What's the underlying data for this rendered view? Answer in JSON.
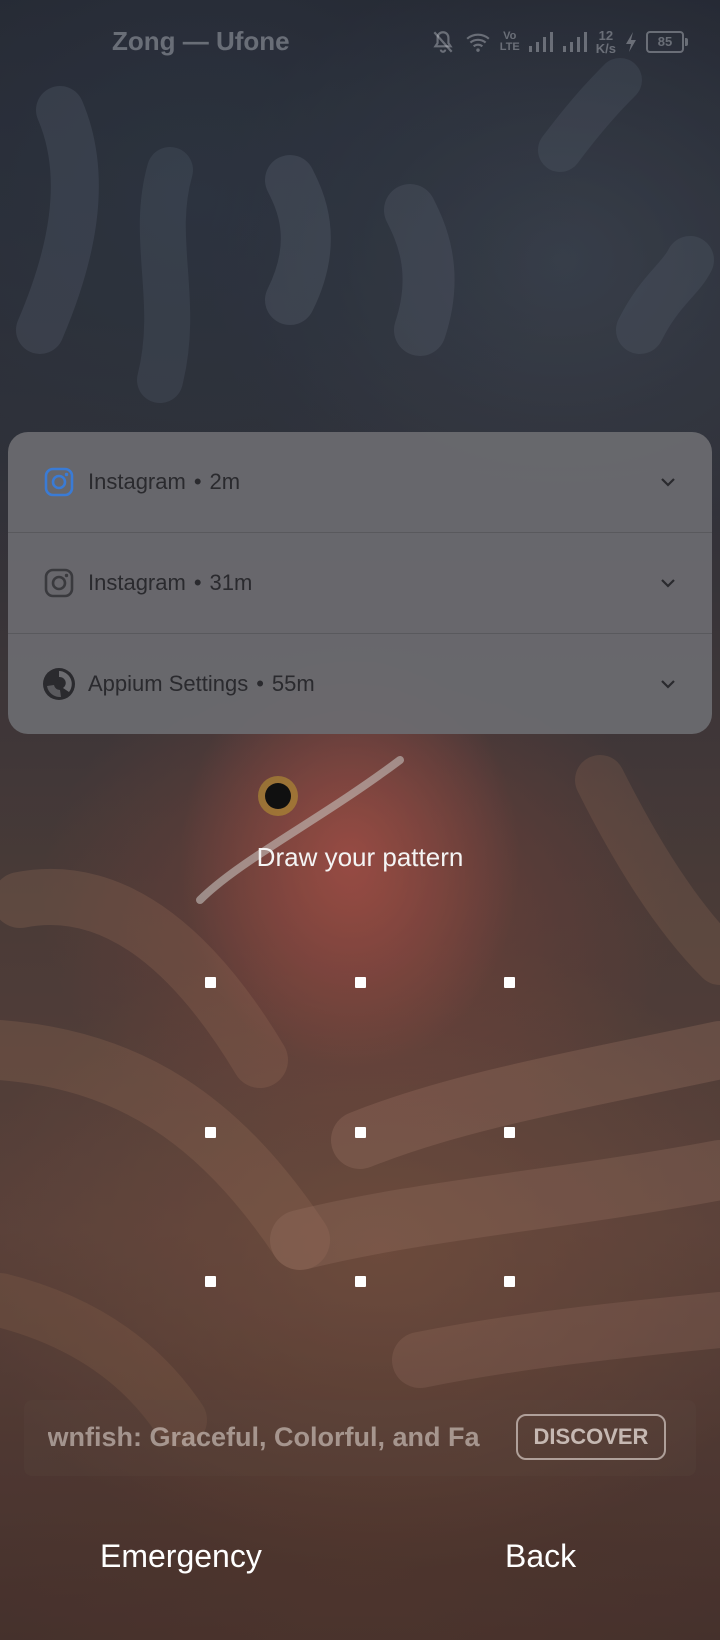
{
  "status_bar": {
    "carrier": "Zong — Ufone",
    "volte_top": "Vo",
    "volte_bottom": "LTE",
    "speed_value": "12",
    "speed_unit": "K/s",
    "battery": "85",
    "icons": [
      "bell-off-icon",
      "wifi-icon",
      "volte-icon",
      "signal-icon",
      "signal-icon",
      "net-speed",
      "charging-icon",
      "battery-icon"
    ]
  },
  "notifications": [
    {
      "app": "Instagram",
      "time": "2m",
      "icon": "instagram-icon",
      "color": "#3a7bd5"
    },
    {
      "app": "Instagram",
      "time": "31m",
      "icon": "instagram-icon",
      "color": "#3a3a3e"
    },
    {
      "app": "Appium Settings",
      "time": "55m",
      "icon": "appium-icon",
      "color": "#2a2a2e"
    }
  ],
  "lock": {
    "prompt": "Draw your pattern",
    "grid": [
      3,
      3
    ]
  },
  "discover": {
    "title": "Clownfish: Graceful, Colorful, and Fa",
    "button": "DISCOVER"
  },
  "actions": {
    "emergency": "Emergency",
    "back": "Back"
  },
  "colors": {
    "text_light": "#ffffff",
    "panel": "#6c6c70",
    "instagram_accent": "#3a7bd5"
  }
}
